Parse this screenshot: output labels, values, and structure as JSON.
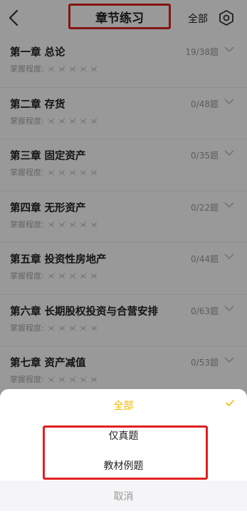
{
  "header": {
    "title": "章节练习",
    "filter_label": "全部",
    "icons": {
      "back": "chevron-left-icon",
      "settings": "hexagon-settings-icon"
    }
  },
  "chapters": [
    {
      "title": "第一章   总论",
      "count": "19/38题",
      "mastery_label": "掌握程度:"
    },
    {
      "title": "第二章   存货",
      "count": "0/48题",
      "mastery_label": "掌握程度:"
    },
    {
      "title": "第三章   固定资产",
      "count": "0/35题",
      "mastery_label": "掌握程度:"
    },
    {
      "title": "第四章   无形资产",
      "count": "0/22题",
      "mastery_label": "掌握程度:"
    },
    {
      "title": "第五章   投资性房地产",
      "count": "0/44题",
      "mastery_label": "掌握程度:"
    },
    {
      "title": "第六章   长期股权投资与合营安排",
      "count": "0/63题",
      "mastery_label": "掌握程度:"
    },
    {
      "title": "第七章   资产减值",
      "count": "0/53题",
      "mastery_label": "掌握程度:"
    }
  ],
  "sheet": {
    "options": [
      {
        "label": "全部",
        "selected": true
      },
      {
        "label": "仅真题",
        "selected": false
      },
      {
        "label": "教材例题",
        "selected": false
      }
    ],
    "cancel_label": "取消"
  },
  "colors": {
    "accent": "#f2b600",
    "highlight_box": "#e02020",
    "overlay": "rgba(0,0,0,0.40)"
  }
}
